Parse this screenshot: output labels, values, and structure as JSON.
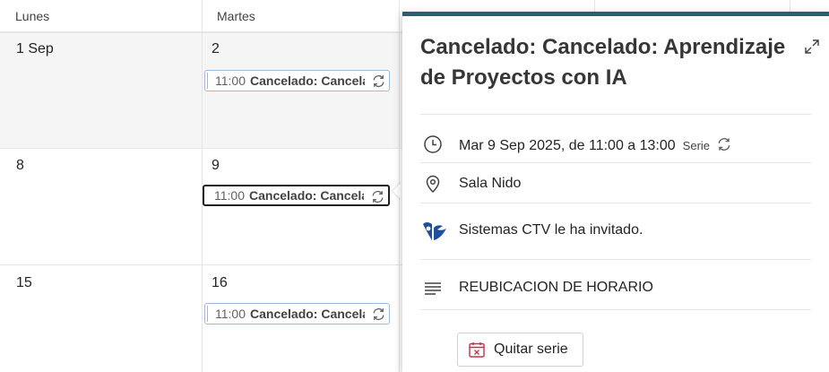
{
  "calendar": {
    "headers": [
      "Lunes",
      "Martes"
    ],
    "weeks": [
      {
        "monday": "1 Sep",
        "tuesday": "2"
      },
      {
        "monday": "8",
        "tuesday": "9"
      },
      {
        "monday": "15",
        "tuesday": "16"
      }
    ],
    "events": [
      {
        "time": "11:00",
        "title": "Cancelado: Cancelado: Aprendizaje de Proyectos con IA"
      },
      {
        "time": "11:00",
        "title": "Cancelado: Cancelado: Aprendizaje de Proyectos con IA"
      },
      {
        "time": "11:00",
        "title": "Cancelado: Cancelado: Aprendizaje de Proyectos con IA"
      }
    ]
  },
  "popup": {
    "title": "Cancelado: Cancelado: Aprendizaje de Proyectos con IA",
    "datetime": "Mar 9 Sep 2025, de 11:00 a 13:00",
    "series_label": "Serie",
    "location": "Sala Nido",
    "invited_by": "Sistemas CTV le ha invitado.",
    "description": "REUBICACION DE HORARIO",
    "remove_series_button": "Quitar serie",
    "accent_color": "#2b5f70",
    "icons": [
      "expand-icon",
      "clock-icon",
      "recurring-icon",
      "location-icon",
      "organizer-logo-icon",
      "notes-icon",
      "calendar-remove-icon"
    ]
  }
}
